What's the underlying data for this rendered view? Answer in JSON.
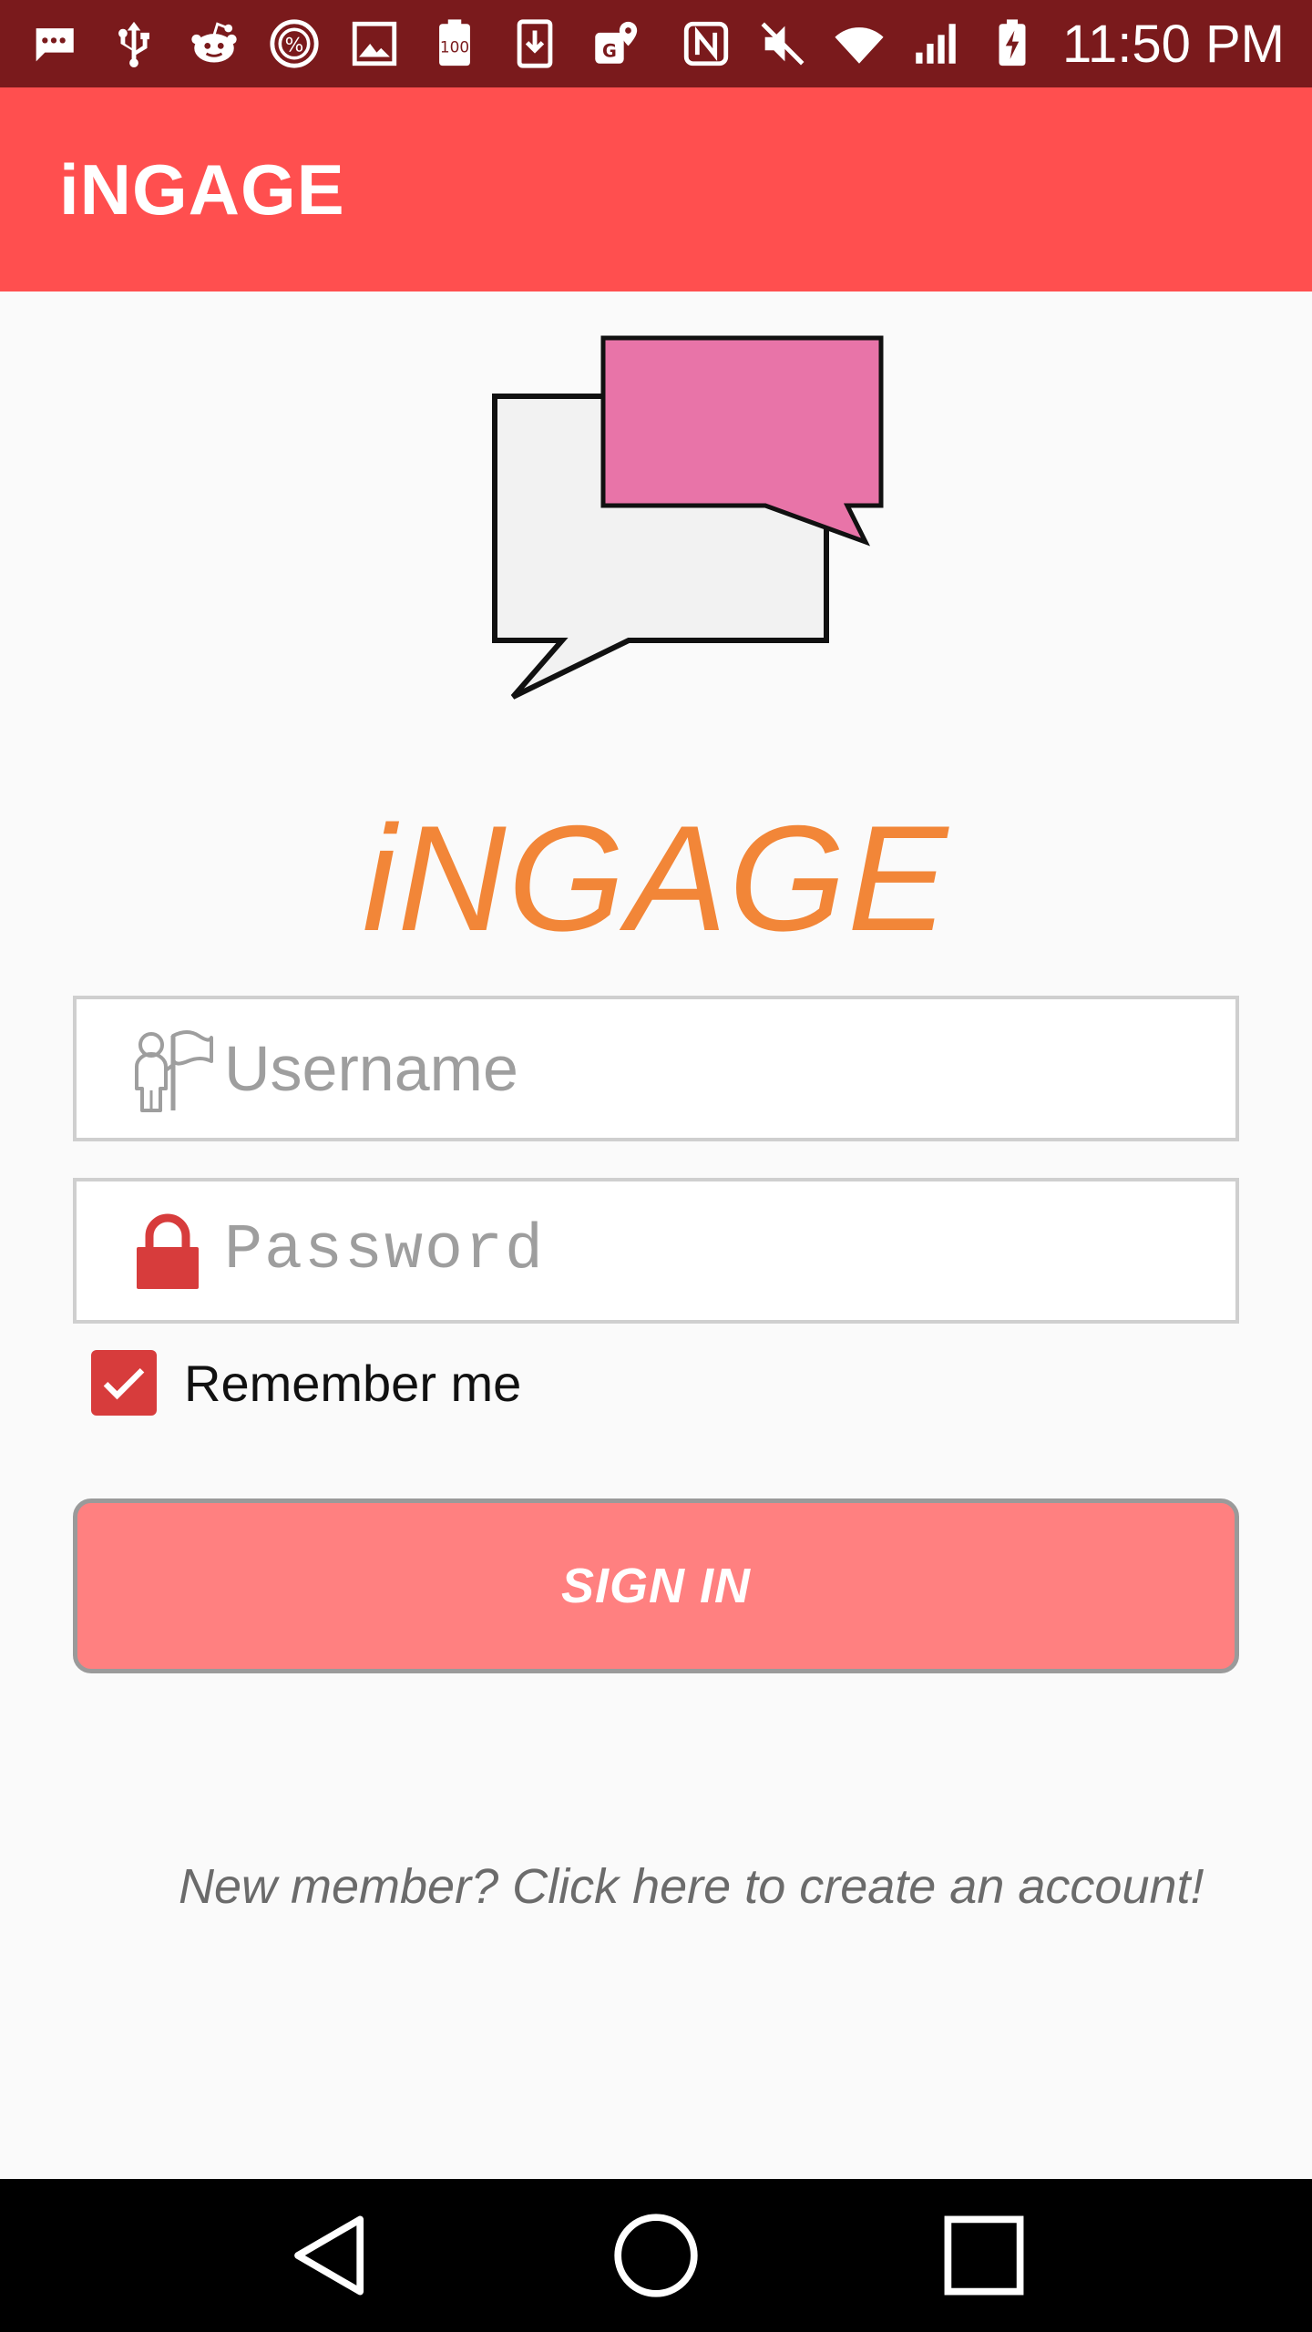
{
  "status_bar": {
    "time": "11:50 PM",
    "left_icons": [
      "message-icon",
      "usb-icon",
      "reddit-icon",
      "percent-icon",
      "image-icon",
      "battery-100-icon",
      "download-icon",
      "maps-icon"
    ],
    "right_icons": [
      "nfc-icon",
      "mute-icon",
      "wifi-icon",
      "signal-icon",
      "battery-charging-icon"
    ]
  },
  "app_bar": {
    "title": "iNGAGE"
  },
  "brand": {
    "title": "iNGAGE",
    "color": "#f28638"
  },
  "form": {
    "username_placeholder": "Username",
    "username_value": "",
    "password_placeholder": "Password",
    "password_value": "",
    "remember_label": "Remember me",
    "remember_checked": true,
    "signin_label": "SIGN IN"
  },
  "signup": {
    "text": "New member? Click here to create an account!"
  },
  "colors": {
    "status_bar": "#7a1a1c",
    "app_bar": "#ff4f4f",
    "signin_button": "#ff8080",
    "accent": "#d73c3c",
    "logo_pink": "#e874a8"
  },
  "nav_bar": {
    "buttons": [
      "back-icon",
      "home-icon",
      "recents-icon"
    ]
  }
}
